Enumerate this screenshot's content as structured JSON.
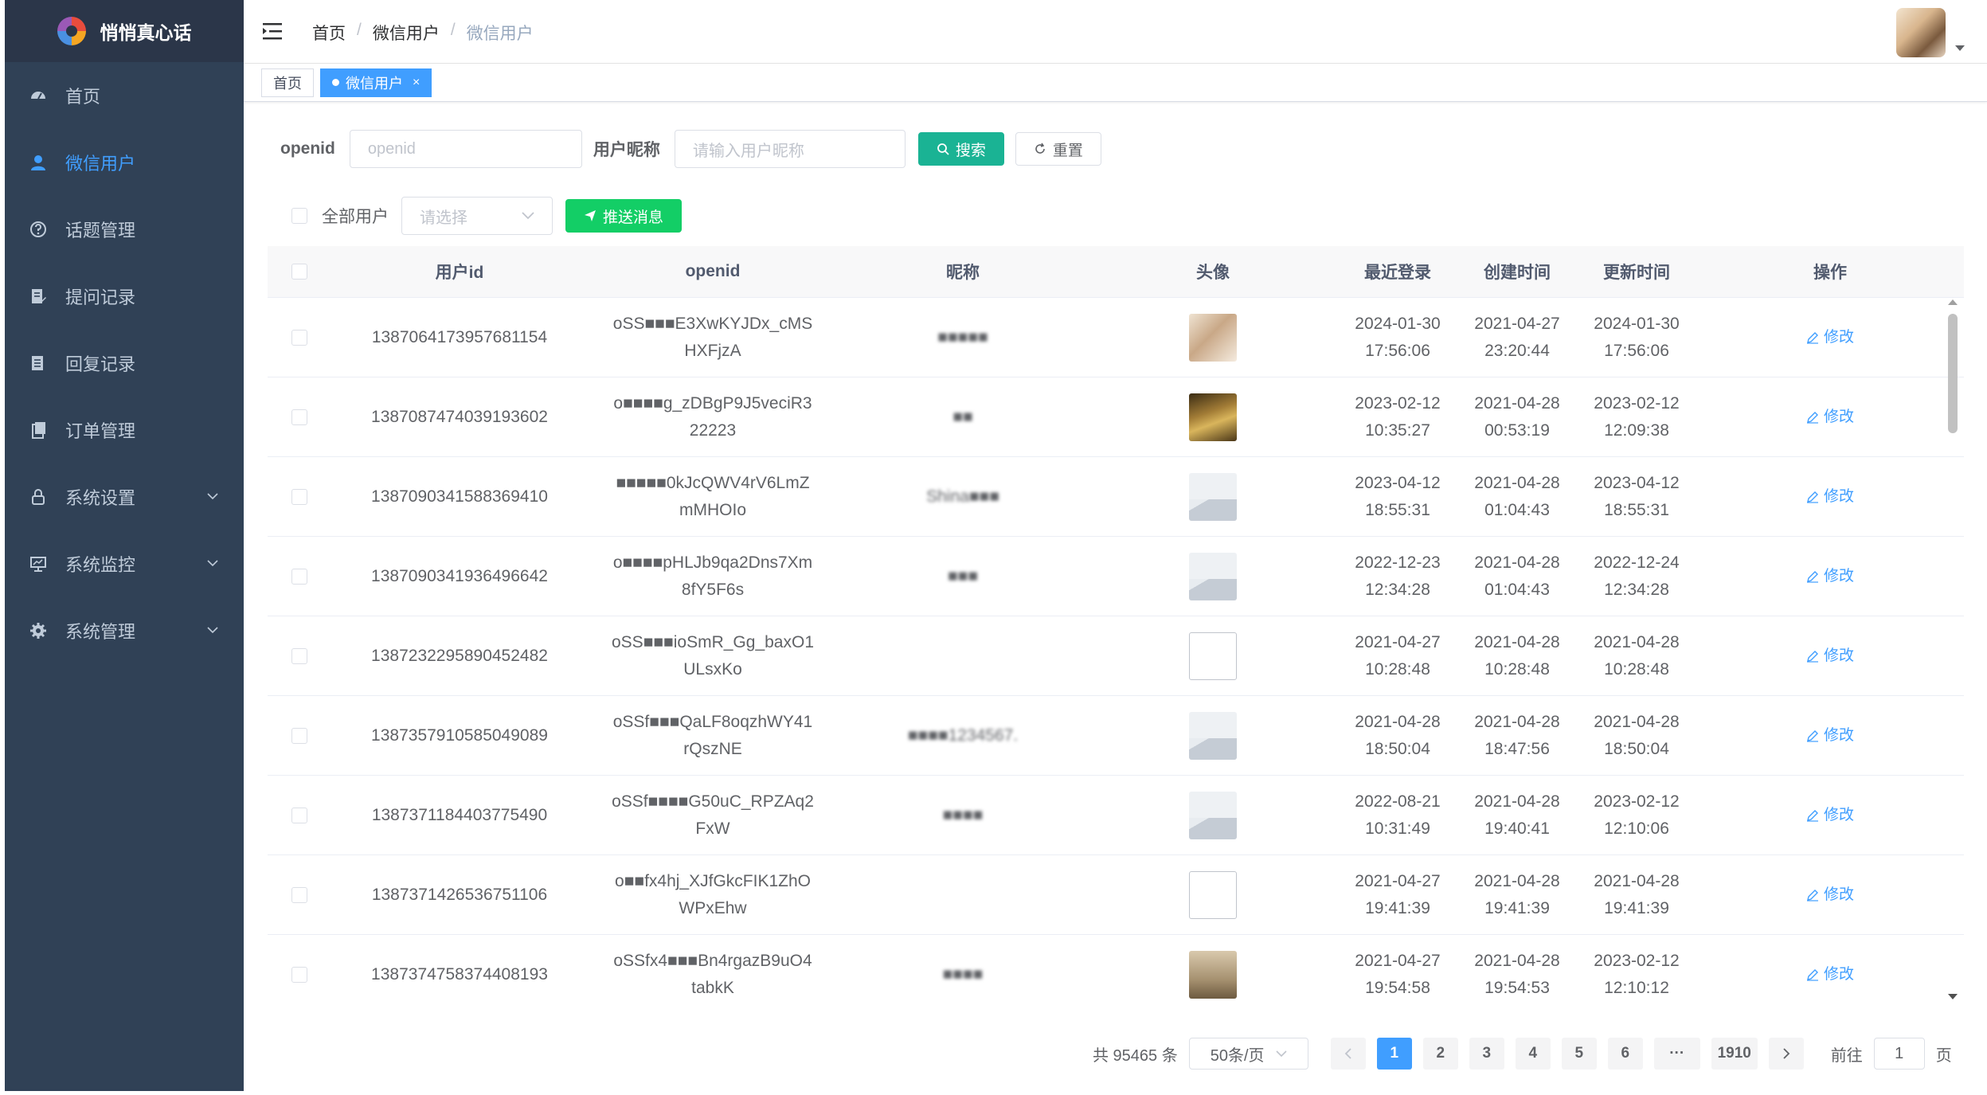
{
  "app": {
    "title": "悄悄真心话"
  },
  "sidebar": {
    "items": [
      {
        "label": "首页",
        "icon": "dashboard-icon",
        "active": false,
        "expandable": false
      },
      {
        "label": "微信用户",
        "icon": "user-icon",
        "active": true,
        "expandable": false
      },
      {
        "label": "话题管理",
        "icon": "question-icon",
        "active": false,
        "expandable": false
      },
      {
        "label": "提问记录",
        "icon": "edit-doc-icon",
        "active": false,
        "expandable": false
      },
      {
        "label": "回复记录",
        "icon": "doc-icon",
        "active": false,
        "expandable": false
      },
      {
        "label": "订单管理",
        "icon": "clipboard-icon",
        "active": false,
        "expandable": false
      },
      {
        "label": "系统设置",
        "icon": "lock-icon",
        "active": false,
        "expandable": true
      },
      {
        "label": "系统监控",
        "icon": "monitor-icon",
        "active": false,
        "expandable": true
      },
      {
        "label": "系统管理",
        "icon": "gear-icon",
        "active": false,
        "expandable": true
      }
    ]
  },
  "header": {
    "breadcrumb": [
      "首页",
      "微信用户",
      "微信用户"
    ],
    "breadcrumb_sep": "/"
  },
  "tags": {
    "home": "首页",
    "current": "微信用户",
    "close": "×"
  },
  "search": {
    "openid_label": "openid",
    "openid_placeholder": "openid",
    "nickname_label": "用户昵称",
    "nickname_placeholder": "请输入用户昵称",
    "search_button": "搜索",
    "reset_button": "重置"
  },
  "push": {
    "all_users_label": "全部用户",
    "select_placeholder": "请选择",
    "push_button": "推送消息"
  },
  "table": {
    "columns": [
      "用户id",
      "openid",
      "昵称",
      "头像",
      "最近登录",
      "创建时间",
      "更新时间",
      "操作"
    ],
    "edit_label": "修改",
    "rows": [
      {
        "id": "1387064173957681154",
        "openid": "oSS■■■E3XwKYJDx_cMSHXFjzA",
        "nickname": "■■■■■",
        "avatar": "photo1",
        "login": [
          "2024-01-30",
          "17:56:06"
        ],
        "created": [
          "2021-04-27",
          "23:20:44"
        ],
        "updated": [
          "2024-01-30",
          "17:56:06"
        ]
      },
      {
        "id": "1387087474039193602",
        "openid": "o■■■■g_zDBgP9J5veciR322223",
        "nickname": "■■",
        "avatar": "photo2",
        "login": [
          "2023-02-12",
          "10:35:27"
        ],
        "created": [
          "2021-04-28",
          "00:53:19"
        ],
        "updated": [
          "2023-02-12",
          "12:09:38"
        ]
      },
      {
        "id": "1387090341588369410",
        "openid": "■■■■■0kJcQWV4rV6LmZmMHOIo",
        "nickname": "Shina■■■",
        "avatar": "placeholder",
        "login": [
          "2023-04-12",
          "18:55:31"
        ],
        "created": [
          "2021-04-28",
          "01:04:43"
        ],
        "updated": [
          "2023-04-12",
          "18:55:31"
        ]
      },
      {
        "id": "1387090341936496642",
        "openid": "o■■■■pHLJb9qa2Dns7Xm8fY5F6s",
        "nickname": "■■■",
        "avatar": "placeholder",
        "login": [
          "2022-12-23",
          "12:34:28"
        ],
        "created": [
          "2021-04-28",
          "01:04:43"
        ],
        "updated": [
          "2022-12-24",
          "12:34:28"
        ]
      },
      {
        "id": "1387232295890452482",
        "openid": "oSS■■■ioSmR_Gg_baxO1ULsxKo",
        "nickname": "",
        "avatar": "broken",
        "login": [
          "2021-04-27",
          "10:28:48"
        ],
        "created": [
          "2021-04-28",
          "10:28:48"
        ],
        "updated": [
          "2021-04-28",
          "10:28:48"
        ]
      },
      {
        "id": "1387357910585049089",
        "openid": "oSSf■■■QaLF8oqzhWY41rQszNE",
        "nickname": "■■■■1234567.",
        "avatar": "placeholder",
        "login": [
          "2021-04-28",
          "18:50:04"
        ],
        "created": [
          "2021-04-28",
          "18:47:56"
        ],
        "updated": [
          "2021-04-28",
          "18:50:04"
        ]
      },
      {
        "id": "1387371184403775490",
        "openid": "oSSf■■■■G50uC_RPZAq2FxW",
        "nickname": "■■■■",
        "avatar": "placeholder",
        "login": [
          "2022-08-21",
          "10:31:49"
        ],
        "created": [
          "2021-04-28",
          "19:40:41"
        ],
        "updated": [
          "2023-02-12",
          "12:10:06"
        ]
      },
      {
        "id": "1387371426536751106",
        "openid": "o■■fx4hj_XJfGkcFIK1ZhOWPxEhw",
        "nickname": "",
        "avatar": "broken",
        "login": [
          "2021-04-27",
          "19:41:39"
        ],
        "created": [
          "2021-04-28",
          "19:41:39"
        ],
        "updated": [
          "2021-04-28",
          "19:41:39"
        ]
      },
      {
        "id": "1387374758374408193",
        "openid": "oSSfx4■■■Bn4rgazB9uO4tabkK",
        "nickname": "■■■■",
        "avatar": "photo3",
        "login": [
          "2021-04-27",
          "19:54:58"
        ],
        "created": [
          "2021-04-28",
          "19:54:53"
        ],
        "updated": [
          "2023-02-12",
          "12:10:12"
        ]
      }
    ]
  },
  "pagination": {
    "total_text": "共 95465 条",
    "page_size": "50条/页",
    "pages": [
      "1",
      "2",
      "3",
      "4",
      "5",
      "6",
      "···",
      "1910"
    ],
    "current_page": "1",
    "goto_label": "前往",
    "goto_value": "1",
    "page_suffix": "页"
  },
  "colors": {
    "sidebar_bg": "#304156",
    "logo_bg": "#2b3649",
    "accent": "#409eff",
    "search_button": "#1ab394",
    "push_button": "#13ce66"
  }
}
